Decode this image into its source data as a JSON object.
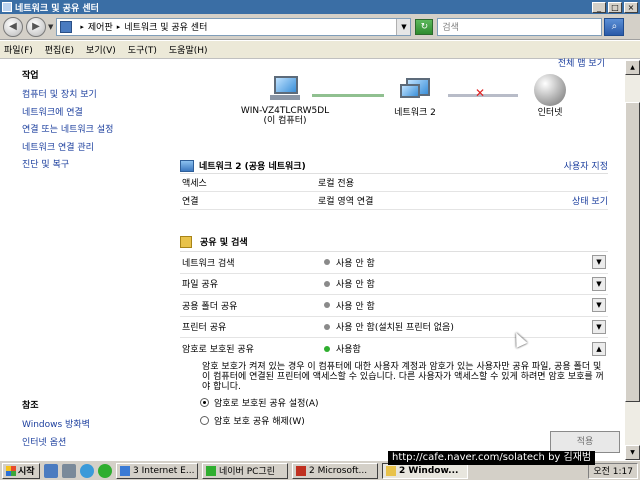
{
  "window": {
    "title": "네트워크 및 공유 센터"
  },
  "addressbar": {
    "crumb1": "제어판",
    "crumb2": "네트워크 및 공유 센터",
    "search_placeholder": "검색"
  },
  "menu": [
    "파일(F)",
    "편집(E)",
    "보기(V)",
    "도구(T)",
    "도움말(H)"
  ],
  "tasks": {
    "heading": "작업",
    "items": [
      "컴퓨터 및 장치 보기",
      "네트워크에 연결",
      "연결 또는 네트워크 설정",
      "네트워크 연결 관리",
      "진단 및 복구"
    ]
  },
  "see_also": {
    "heading": "참조",
    "items": [
      "Windows 방화벽",
      "인터넷 옵션"
    ]
  },
  "map": {
    "view_full_map": "전체 맵 보기",
    "computer_name": "WIN-VZ4TLCRW5DL",
    "computer_sub": "(이 컴퓨터)",
    "network_name": "네트워크 2",
    "internet": "인터넷"
  },
  "network_section": {
    "title": "네트워크 2 (공용 네트워크)",
    "customize": "사용자 지정",
    "rows": [
      {
        "key": "액세스",
        "value": "로컬 전용",
        "link": ""
      },
      {
        "key": "연결",
        "value": "로컬 영역 연결",
        "link": "상태 보기"
      }
    ]
  },
  "sharing_section": {
    "title": "공유 및 검색",
    "rows": [
      {
        "key": "네트워크 검색",
        "value": "사용 안 함",
        "on": false,
        "expanded": false
      },
      {
        "key": "파일 공유",
        "value": "사용 안 함",
        "on": false,
        "expanded": false
      },
      {
        "key": "공용 폴더 공유",
        "value": "사용 안 함",
        "on": false,
        "expanded": false
      },
      {
        "key": "프린터 공유",
        "value": "사용 안 함(설치된 프린터 없음)",
        "on": false,
        "expanded": false
      },
      {
        "key": "암호로 보호된 공유",
        "value": "사용함",
        "on": true,
        "expanded": true
      }
    ],
    "description": "암호 보호가 켜져 있는 경우 이 컴퓨터에 대한 사용자 계정과 암호가 있는 사용자만 공유 파일, 공용 폴더 및 이 컴퓨터에 연결된 프린터에 액세스할 수 있습니다. 다른 사용자가 액세스할 수 있게 하려면 암호 보호를 꺼야 합니다.",
    "options": [
      {
        "label": "암호로 보호된 공유 설정(A)",
        "selected": true
      },
      {
        "label": "암호 보호 공유 해제(W)",
        "selected": false
      }
    ],
    "apply_label": "적용"
  },
  "taskbar": {
    "start": "시작",
    "buttons": [
      {
        "label": "3 Internet E...",
        "active": false,
        "color": "#3a7bd5"
      },
      {
        "label": "네이버 PC그린",
        "active": false,
        "color": "#2fae2f"
      },
      {
        "label": "2 Microsoft...",
        "active": false,
        "color": "#c03020"
      },
      {
        "label": "2 Window...",
        "active": true,
        "color": "#e8c24a"
      }
    ],
    "clock": "오전 1:17"
  },
  "watermark": "http://cafe.naver.com/solatech by 김재범",
  "colors": {
    "link": "#1c3f9e",
    "titlebar": "#3a6ea5",
    "on_dot": "#2fae2f",
    "off_dot": "#8a8a8a"
  }
}
